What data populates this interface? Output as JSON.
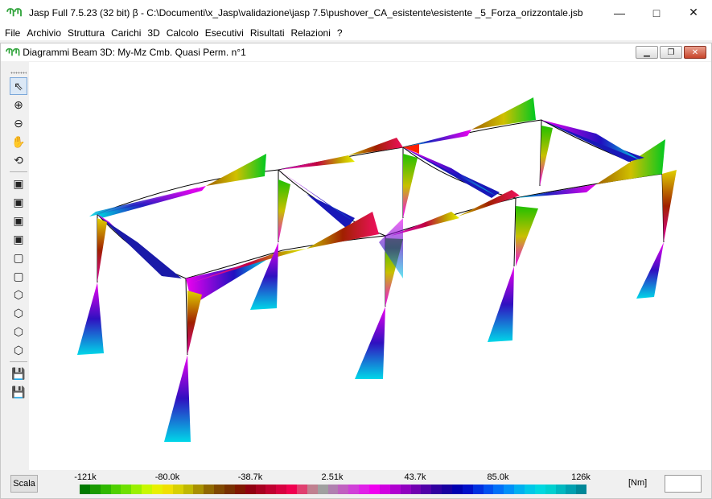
{
  "window": {
    "title": "Jasp Full 7.5.23 (32 bit)  β - C:\\Documenti\\x_Jasp\\validazione\\jasp 7.5\\pushover_CA_esistente\\esistente _5_Forza_orizzontale.jsb",
    "icon_text": "ՊՊ"
  },
  "menu": [
    "File",
    "Archivio",
    "Struttura",
    "Carichi",
    "3D",
    "Calcolo",
    "Esecutivi",
    "Risultati",
    "Relazioni",
    "?"
  ],
  "child_window": {
    "title": "Diagrammi Beam 3D: My-Mz Cmb. Quasi Perm. n°1",
    "icon_text": "ՊՊ"
  },
  "toolbar": [
    {
      "name": "select-arrow-icon",
      "glyph": "⇖"
    },
    {
      "name": "zoom-in-icon",
      "glyph": "⊕"
    },
    {
      "name": "zoom-out-icon",
      "glyph": "⊖"
    },
    {
      "name": "pan-hand-icon",
      "glyph": "✋"
    },
    {
      "name": "rotate-icon",
      "glyph": "⟲"
    },
    {
      "sep": true
    },
    {
      "name": "view-iso-1-icon",
      "glyph": "▣"
    },
    {
      "name": "view-iso-2-icon",
      "glyph": "▣"
    },
    {
      "name": "view-iso-3-icon",
      "glyph": "▣"
    },
    {
      "name": "view-iso-4-icon",
      "glyph": "▣"
    },
    {
      "name": "view-front-icon",
      "glyph": "▢"
    },
    {
      "name": "view-back-icon",
      "glyph": "▢"
    },
    {
      "name": "view-left-icon",
      "glyph": "⬡"
    },
    {
      "name": "view-right-icon",
      "glyph": "⬡"
    },
    {
      "name": "view-top-icon",
      "glyph": "⬡"
    },
    {
      "name": "view-bottom-icon",
      "glyph": "⬡"
    },
    {
      "sep": true
    },
    {
      "name": "save-icon",
      "glyph": "💾"
    },
    {
      "name": "save-as-icon",
      "glyph": "💾"
    }
  ],
  "legend": {
    "button": "Scala",
    "ticks": [
      "-121k",
      "-80.0k",
      "-38.7k",
      "2.51k",
      "43.7k",
      "85.0k",
      "126k"
    ],
    "unit": "[Nm]",
    "colors": [
      "#007a00",
      "#1a9a00",
      "#2fb800",
      "#4ed000",
      "#6ee000",
      "#9af000",
      "#c8f800",
      "#e8f000",
      "#f0e000",
      "#d8d000",
      "#c0b800",
      "#a89000",
      "#906800",
      "#804800",
      "#783000",
      "#801800",
      "#900010",
      "#a80020",
      "#c00030",
      "#d80040",
      "#f00050",
      "#e04070",
      "#c08090",
      "#a0a0a0",
      "#b080b0",
      "#c060c0",
      "#d040d8",
      "#e020e8",
      "#f000f0",
      "#d000e0",
      "#b000d0",
      "#9000c0",
      "#7000b0",
      "#5000a8",
      "#3000a0",
      "#1800a0",
      "#0000b0",
      "#0010c8",
      "#0030e0",
      "#0050f0",
      "#0070f8",
      "#0090f8",
      "#00b0f0",
      "#00c8e8",
      "#00d8e0",
      "#00d0d0",
      "#00b8c0",
      "#00a0b0",
      "#008898"
    ]
  }
}
